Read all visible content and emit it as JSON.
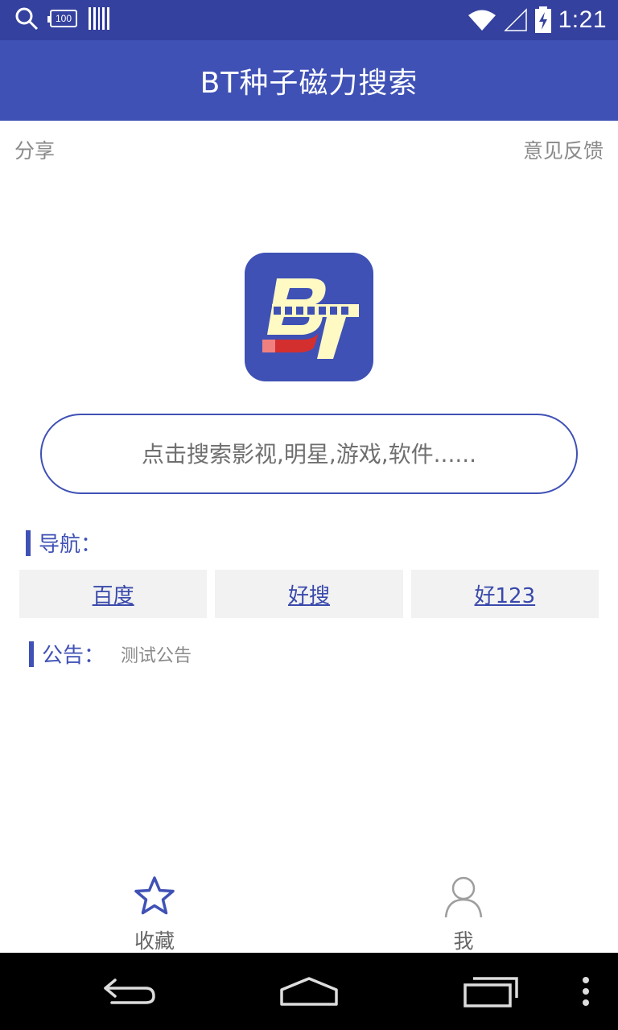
{
  "status_bar": {
    "time": "1:21",
    "battery_level_text": "100",
    "icons": [
      "search-icon",
      "battery-100-icon",
      "barcode-icon",
      "wifi-icon",
      "signal-icon",
      "battery-charging-icon"
    ]
  },
  "app_bar": {
    "title": "BT种子磁力搜索"
  },
  "top_links": {
    "share": "分享",
    "feedback": "意见反馈"
  },
  "logo": {
    "text": "BT"
  },
  "search": {
    "placeholder": "点击搜索影视,明星,游戏,软件......"
  },
  "nav": {
    "title": "导航：",
    "items": [
      {
        "label": "百度"
      },
      {
        "label": "好搜"
      },
      {
        "label": "好123"
      }
    ]
  },
  "notice": {
    "title": "公告：",
    "text": "测试公告"
  },
  "tabs": [
    {
      "label": "收藏",
      "icon": "star-icon",
      "active": true
    },
    {
      "label": "我",
      "icon": "person-icon",
      "active": false
    }
  ],
  "colors": {
    "primary": "#3f51b5",
    "status_bar": "#34419e",
    "link": "#3949ab",
    "gray_text": "#8a8a8a"
  }
}
